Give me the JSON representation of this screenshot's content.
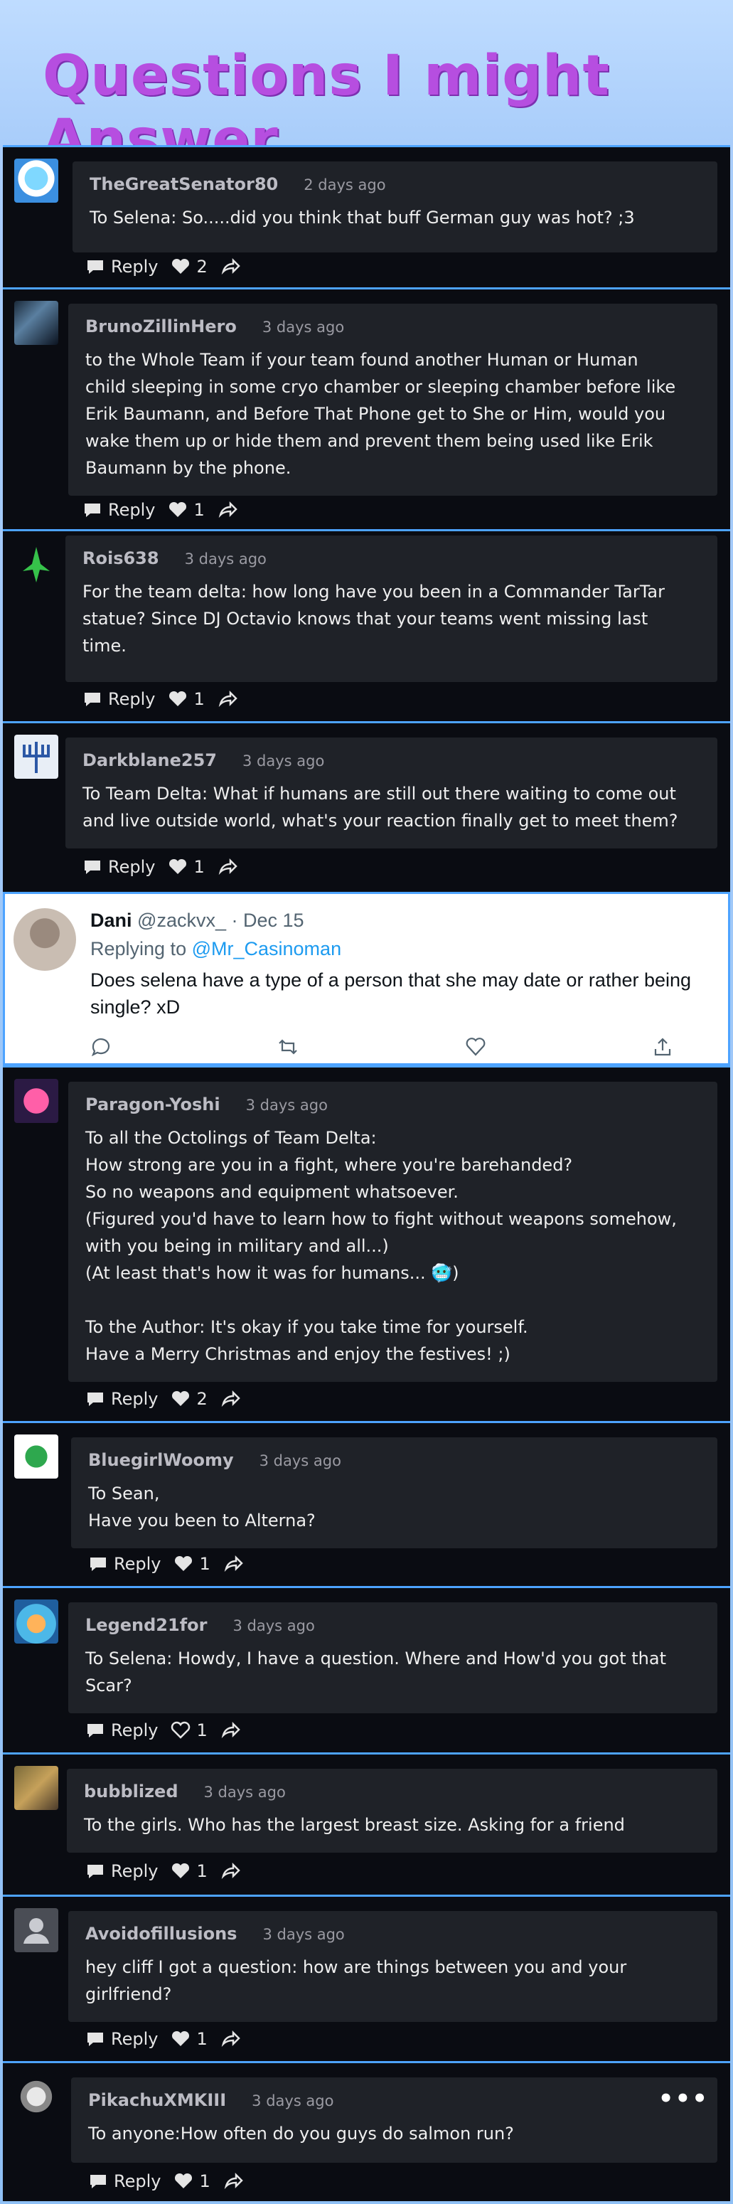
{
  "page_title": "Questions I might Answer",
  "colors": {
    "title": "#b64ee0",
    "card_bg": "#0a0c12",
    "bubble_bg": "#1f2228",
    "border": "#4da3ff"
  },
  "comments": [
    {
      "user": "TheGreatSenator80",
      "date": "2 days ago",
      "text": "To Selena: So.....did you think that buff German guy was hot? ;3",
      "reply": "Reply",
      "likes": "2"
    },
    {
      "user": "BrunoZillinHero",
      "date": "3 days ago",
      "text": "to the Whole Team if your team found another Human or Human\nchild sleeping in some cryo chamber or sleeping chamber before like\nErik Baumann, and Before That Phone get to She or Him, would you\nwake them up or hide them and prevent them being used like Erik\nBaumann by the phone.",
      "reply": "Reply",
      "likes": "1"
    },
    {
      "user": "Rois638",
      "date": "3 days ago",
      "text": "For the team delta: how long have you been in a Commander TarTar\nstatue? Since DJ Octavio knows that your teams went missing last\ntime.",
      "reply": "Reply",
      "likes": "1"
    },
    {
      "user": "Darkblane257",
      "date": "3 days ago",
      "text": "To Team Delta: What if humans are still out there waiting to come out\nand live outside world, what's your reaction finally get to meet them?",
      "reply": "Reply",
      "likes": "1"
    },
    {
      "user": "Paragon-Yoshi",
      "date": "3 days ago",
      "text": "To all the Octolings of Team Delta:\nHow strong are you in a fight, where you're barehanded?\nSo no weapons and equipment whatsoever.\n(Figured you'd have to learn how to fight without weapons somehow,\nwith you being in military and all...)\n(At least that's how it was for humans... 🥶)\n\nTo the Author: It's okay if you take time for yourself.\nHave a Merry Christmas and enjoy the festives! ;)",
      "reply": "Reply",
      "likes": "2"
    },
    {
      "user": "BluegirlWoomy",
      "date": "3 days ago",
      "text": "To Sean,\nHave you been to Alterna?",
      "reply": "Reply",
      "likes": "1"
    },
    {
      "user": "Legend21for",
      "date": "3 days ago",
      "text": "To Selena: Howdy, I have a question. Where and How'd you got that\nScar?",
      "reply": "Reply",
      "likes": "1"
    },
    {
      "user": "bubblized",
      "date": "3 days ago",
      "text": "To the girls. Who has the largest breast size. Asking for a friend",
      "reply": "Reply",
      "likes": "1"
    },
    {
      "user": "Avoidofillusions",
      "date": "3 days ago",
      "text": "hey cliff I got a question: how are things between you and your\ngirlfriend?",
      "reply": "Reply",
      "likes": "1"
    },
    {
      "user": "PikachuXMKIII",
      "date": "3 days ago",
      "text": "To anyone:How often do you guys do salmon run?",
      "reply": "Reply",
      "likes": "1",
      "more": "•••"
    }
  ],
  "tweet": {
    "name": "Dani",
    "handle": "@zackvx_",
    "separator": "·",
    "date": "Dec 15",
    "replying_label": "Replying to",
    "replying_to": "@Mr_Casinoman",
    "text": "Does selena have a type of a person that she may date or rather being single? xD"
  }
}
